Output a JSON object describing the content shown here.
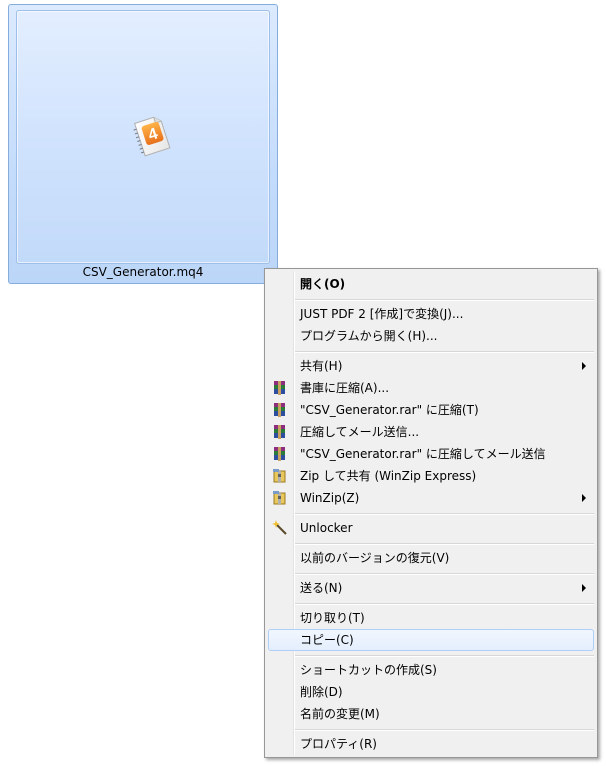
{
  "file": {
    "name": "CSV_Generator.mq4",
    "icon": "mq4-file-icon"
  },
  "menu": {
    "items": [
      {
        "label": "開く(O)",
        "bold": true,
        "icon": null,
        "submenu": false
      },
      {
        "label": "JUST PDF 2 [作成]で変換(J)...",
        "icon": null,
        "submenu": false
      },
      {
        "label": "プログラムから開く(H)...",
        "icon": null,
        "submenu": false
      },
      {
        "label": "共有(H)",
        "icon": null,
        "submenu": true
      },
      {
        "label": "書庫に圧縮(A)...",
        "icon": "winrar-icon",
        "submenu": false
      },
      {
        "label": "\"CSV_Generator.rar\" に圧縮(T)",
        "icon": "winrar-icon",
        "submenu": false
      },
      {
        "label": "圧縮してメール送信...",
        "icon": "winrar-icon",
        "submenu": false
      },
      {
        "label": "\"CSV_Generator.rar\" に圧縮してメール送信",
        "icon": "winrar-icon",
        "submenu": false
      },
      {
        "label": "Zip して共有 (WinZip Express)",
        "icon": "winzip-icon",
        "submenu": false
      },
      {
        "label": "WinZip(Z)",
        "icon": "winzip-icon",
        "submenu": true
      },
      {
        "label": "Unlocker",
        "icon": "unlocker-wand-icon",
        "submenu": false
      },
      {
        "label": "以前のバージョンの復元(V)",
        "icon": null,
        "submenu": false
      },
      {
        "label": "送る(N)",
        "icon": null,
        "submenu": true
      },
      {
        "label": "切り取り(T)",
        "icon": null,
        "submenu": false
      },
      {
        "label": "コピー(C)",
        "icon": null,
        "submenu": false,
        "highlighted": true
      },
      {
        "label": "ショートカットの作成(S)",
        "icon": null,
        "submenu": false
      },
      {
        "label": "削除(D)",
        "icon": null,
        "submenu": false
      },
      {
        "label": "名前の変更(M)",
        "icon": null,
        "submenu": false
      },
      {
        "label": "プロパティ(R)",
        "icon": null,
        "submenu": false
      }
    ]
  },
  "colors": {
    "selection_border": "#84acdd",
    "menu_background": "#f0f0f0",
    "menu_highlight_border": "#aecff7"
  }
}
